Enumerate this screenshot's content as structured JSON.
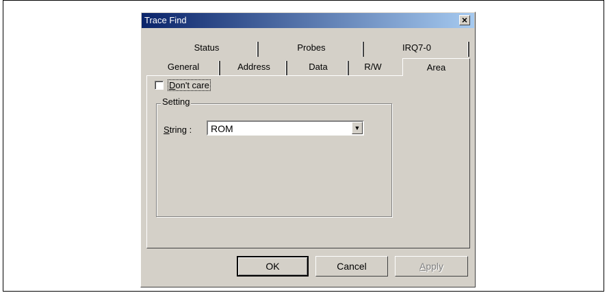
{
  "window": {
    "title": "Trace Find",
    "close_glyph": "×"
  },
  "tabs_row1": [
    {
      "label": "Status"
    },
    {
      "label": "Probes"
    },
    {
      "label": "IRQ7-0"
    }
  ],
  "tabs_row2": [
    {
      "label": "General"
    },
    {
      "label": "Address"
    },
    {
      "label": "Data"
    },
    {
      "label": "R/W"
    },
    {
      "label": "Area",
      "active": true
    }
  ],
  "dont_care": {
    "label_mnemonic": "D",
    "label_rest": "on't care",
    "checked": false
  },
  "setting": {
    "group_label": "Setting",
    "string_label_mnemonic": "S",
    "string_label_rest": "tring :",
    "string_value": "ROM"
  },
  "buttons": {
    "ok": "OK",
    "cancel": "Cancel",
    "apply_mnemonic": "A",
    "apply_rest": "pply"
  }
}
